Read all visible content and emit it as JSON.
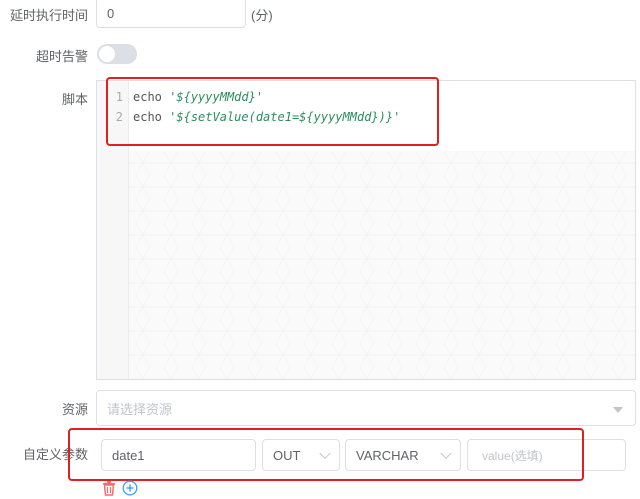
{
  "delay": {
    "label": "延时执行时间",
    "value": "0",
    "unit": "(分)"
  },
  "timeout": {
    "label": "超时告警",
    "enabled": false
  },
  "script": {
    "label": "脚本",
    "lines": [
      {
        "number": "1",
        "keyword": "echo",
        "string": "'${yyyyMMdd}'"
      },
      {
        "number": "2",
        "keyword": "echo",
        "string": "'${setValue(date1=${yyyyMMdd})}'"
      }
    ]
  },
  "resource": {
    "label": "资源",
    "placeholder": "请选择资源"
  },
  "custom_params": {
    "label": "自定义参数",
    "items": [
      {
        "name": "date1",
        "direction": "OUT",
        "type": "VARCHAR",
        "value_placeholder": "value(选填)"
      }
    ]
  },
  "colors": {
    "highlight": "#e02020",
    "accent": "#409eff",
    "delete": "#f56c6c"
  },
  "icons": [
    "delete-icon",
    "add-icon",
    "chevron-down-icon"
  ]
}
